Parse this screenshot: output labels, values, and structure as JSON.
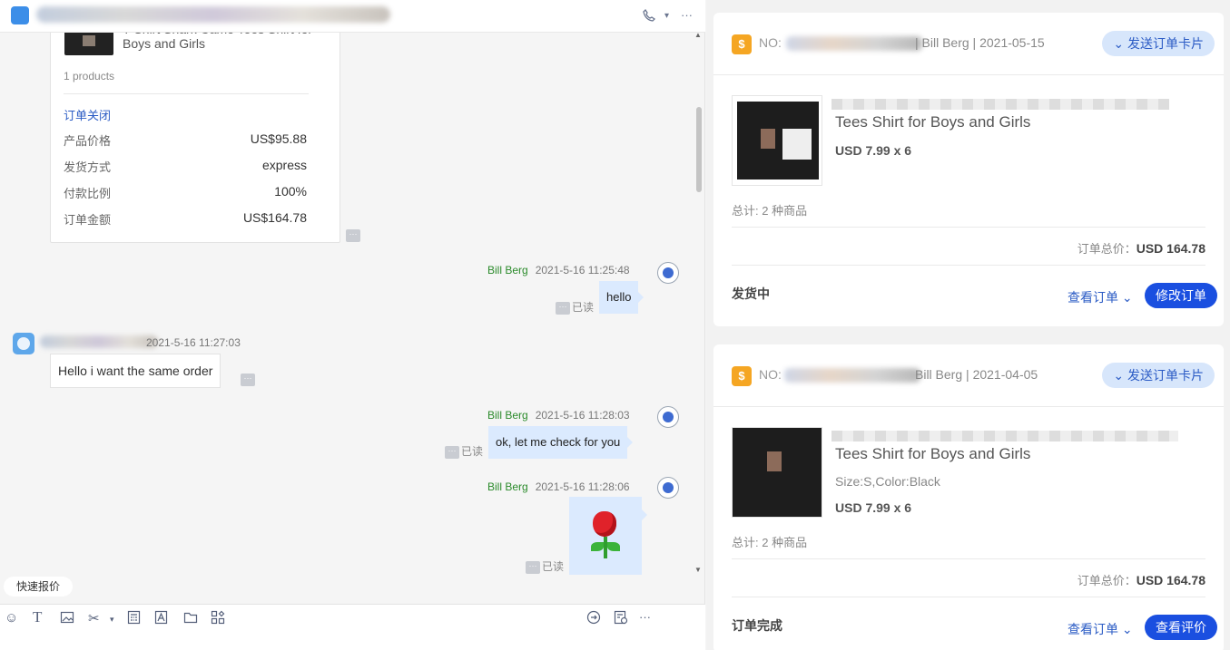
{
  "chat": {
    "header": {
      "call_icon": "phone-icon",
      "caret": "▾",
      "more": "···"
    },
    "order_card": {
      "title": "T-Shirt Shark Camo Tees Shirt for Boys and Girls",
      "product_count": "1 products",
      "status": "订单关闭",
      "rows": [
        {
          "label": "产品价格",
          "value": "US$95.88"
        },
        {
          "label": "发货方式",
          "value": "express"
        },
        {
          "label": "付款比例",
          "value": "100%"
        },
        {
          "label": "订单金额",
          "value": "US$164.78"
        }
      ]
    },
    "messages": [
      {
        "sender": "Bill Berg",
        "time": "2021-5-16 11:25:48",
        "text": "hello",
        "read": "已读"
      },
      {
        "sender": "",
        "time": "2021-5-16 11:27:03",
        "text": "Hello i want the same order"
      },
      {
        "sender": "Bill Berg",
        "time": "2021-5-16 11:28:03",
        "text": "ok, let me check for you",
        "read": "已读"
      },
      {
        "sender": "Bill Berg",
        "time": "2021-5-16 11:28:06",
        "text": "",
        "sticker": "rose",
        "read": "已读"
      }
    ],
    "quick_quote": "快速报价",
    "toolbar_icons": [
      "emoji-icon",
      "text-format-icon",
      "image-icon",
      "scissors-icon",
      "calculator-icon",
      "font-icon",
      "folder-icon",
      "apps-icon",
      "reply-icon",
      "document-icon"
    ],
    "toolbar_more": "···"
  },
  "orders": [
    {
      "no_prefix": "NO:",
      "seller": "Bill Berg",
      "date": "2021-05-15",
      "send_card": "发送订单卡片",
      "product_title": "Tees Shirt for Boys and Girls",
      "product_attr": "",
      "price_qty": "USD 7.99 x 6",
      "total_items": "总计: 2 种商品",
      "grand_total_label": "订单总价：",
      "grand_total_value": "USD 164.78",
      "state": "发货中",
      "view_order": "查看订单",
      "action": "修改订单"
    },
    {
      "no_prefix": "NO:",
      "seller": "Bill Berg",
      "date": "2021-04-05",
      "send_card": "发送订单卡片",
      "product_title": "Tees Shirt for Boys and Girls",
      "product_attr": "Size:S,Color:Black",
      "price_qty": "USD 7.99 x 6",
      "total_items": "总计: 2 种商品",
      "grand_total_label": "订单总价：",
      "grand_total_value": "USD 164.78",
      "state": "订单完成",
      "view_order": "查看订单",
      "action": "查看评价"
    }
  ]
}
